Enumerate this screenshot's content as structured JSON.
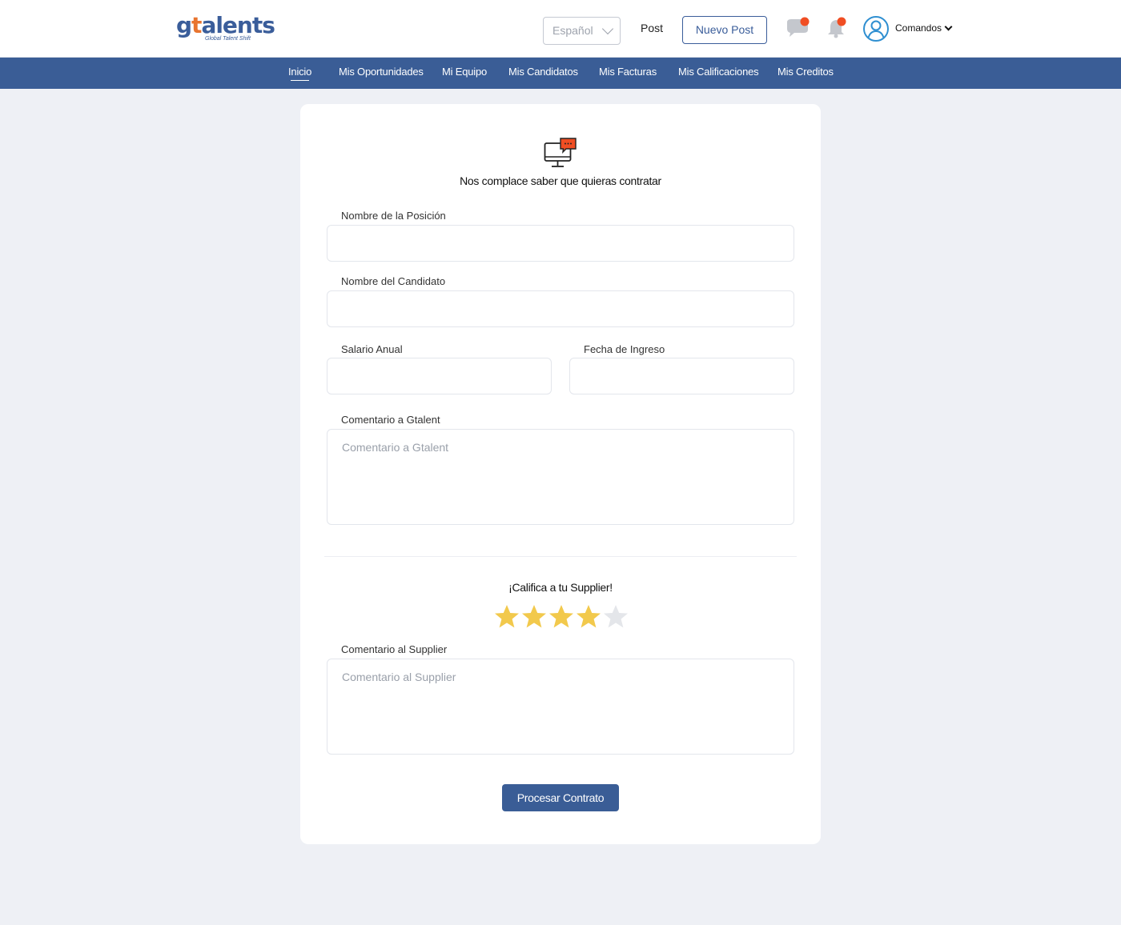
{
  "brand": {
    "logo_text_g": "g",
    "logo_text_t": "t",
    "logo_text_rest": "alents",
    "tagline": "Global Talent Shift",
    "primary_color": "#3a5d96",
    "accent_color": "#e8742f"
  },
  "header": {
    "language_select": "Español",
    "post_link": "Post",
    "new_post_button": "Nuevo Post",
    "chat_icon": "chat-icon",
    "bell_icon": "bell-icon",
    "user_icon": "user-avatar-icon",
    "user_menu": "Comandos",
    "notification_dot_color": "#f04e23"
  },
  "nav": {
    "items": [
      {
        "label": "Inicio",
        "active": true
      },
      {
        "label": "Mis Oportunidades"
      },
      {
        "label": "Mi Equipo"
      },
      {
        "label": "Mis Candidatos"
      },
      {
        "label": "Mis Facturas"
      },
      {
        "label": "Mis Calificaciones"
      },
      {
        "label": "Mis Creditos"
      }
    ]
  },
  "form": {
    "icon": "monitor-chat-icon",
    "title": "Nos complace saber que quieras contratar",
    "position_label": "Nombre de la Posición",
    "position_value": "",
    "candidate_label": "Nombre del Candidato",
    "candidate_value": "",
    "salary_label": "Salario Anual",
    "salary_value": "",
    "start_date_label": "Fecha de Ingreso",
    "start_date_value": "",
    "gtalent_comment_label": "Comentario a Gtalent",
    "gtalent_comment_placeholder": "Comentario a Gtalent",
    "rating_title": "¡Califica a tu Supplier!",
    "rating": {
      "value": 4,
      "max": 5,
      "filled_color": "#f2c94c",
      "empty_color": "#e4e6ea"
    },
    "supplier_comment_label": "Comentario al Supplier",
    "supplier_comment_placeholder": "Comentario al Supplier",
    "submit_button": "Procesar Contrato"
  }
}
